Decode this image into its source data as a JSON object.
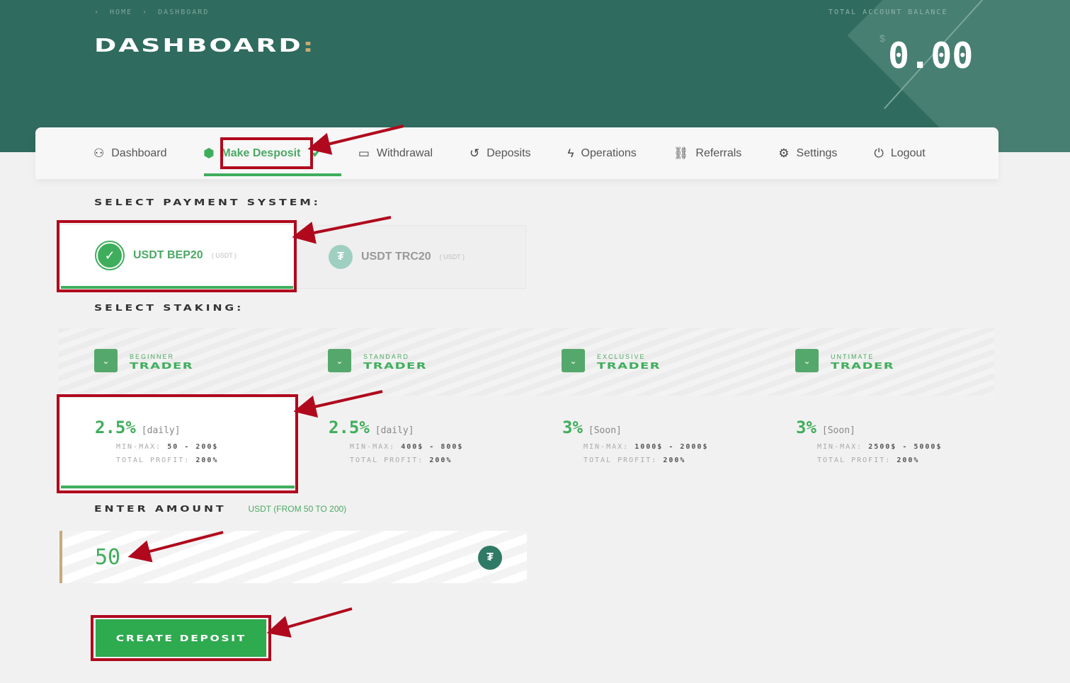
{
  "breadcrumb": [
    "HOME",
    "DASHBOARD"
  ],
  "page_title": "DASHBOARD",
  "balance": {
    "label": "TOTAL ACCOUNT BALANCE",
    "currency": "$",
    "value": "0.00"
  },
  "nav": [
    {
      "label": "Dashboard",
      "icon": "user-icon"
    },
    {
      "label": "Make Desposit",
      "icon": "cube-icon",
      "active": true
    },
    {
      "label": "Withdrawal",
      "icon": "wallet-icon"
    },
    {
      "label": "Deposits",
      "icon": "history-icon"
    },
    {
      "label": "Operations",
      "icon": "bolt-icon"
    },
    {
      "label": "Referrals",
      "icon": "link-icon"
    },
    {
      "label": "Settings",
      "icon": "gear-icon"
    },
    {
      "label": "Logout",
      "icon": "power-icon"
    }
  ],
  "payment": {
    "heading": "SELECT PAYMENT SYSTEM:",
    "options": [
      {
        "name": "USDT BEP20",
        "sub": "( USDT )",
        "selected": true
      },
      {
        "name": "USDT TRC20",
        "sub": "( USDT )",
        "selected": false
      }
    ]
  },
  "staking": {
    "heading": "SELECT STAKING:",
    "min_label": "MIN-MAX:",
    "profit_label": "TOTAL PROFIT:",
    "plans": [
      {
        "tier": "BEGINNER",
        "name": "TRADER",
        "rate": "2.5%",
        "period": "[daily]",
        "minmax": "50 - 200$",
        "profit": "200%",
        "selected": true
      },
      {
        "tier": "STANDARD",
        "name": "TRADER",
        "rate": "2.5%",
        "period": "[daily]",
        "minmax": "400$ - 800$",
        "profit": "200%"
      },
      {
        "tier": "EXCLUSIVE",
        "name": "TRADER",
        "rate": "3%",
        "period": "[Soon]",
        "minmax": "1000$ - 2000$",
        "profit": "200%"
      },
      {
        "tier": "UNTIMATE",
        "name": "TRADER",
        "rate": "3%",
        "period": "[Soon]",
        "minmax": "2500$ - 5000$",
        "profit": "200%"
      }
    ]
  },
  "amount": {
    "heading": "ENTER AMOUNT",
    "hint": "USDT (FROM 50 TO 200)",
    "value": "50"
  },
  "submit_label": "CREATE DEPOSIT",
  "colors": {
    "header": "#2f6b5e",
    "accent": "#3fae5c",
    "annotation": "#b0091d"
  }
}
